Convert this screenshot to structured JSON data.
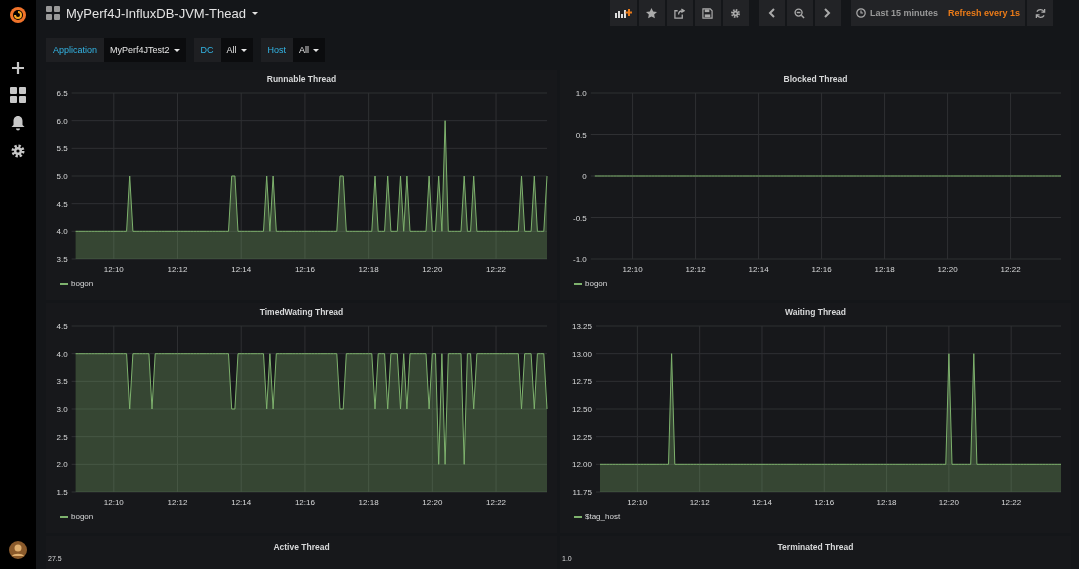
{
  "dashboard": {
    "title": "MyPerf4J-InfluxDB-JVM-Thead"
  },
  "toolbar": {
    "time_range": "Last 15 minutes",
    "refresh": "Refresh every 1s"
  },
  "variables": [
    {
      "label": "Application",
      "value": "MyPerf4JTest2"
    },
    {
      "label": "DC",
      "value": "All"
    },
    {
      "label": "Host",
      "value": "All"
    }
  ],
  "panels": [
    {
      "title": "Runnable Thread",
      "chart_data": {
        "type": "area",
        "grid": true,
        "ylim": [
          3.5,
          6.5
        ],
        "yticks": [
          {
            "value": 3.5,
            "label": "3.5"
          },
          {
            "value": 4,
            "label": "4.0"
          },
          {
            "value": 4.5,
            "label": "4.5"
          },
          {
            "value": 5,
            "label": "5.0"
          },
          {
            "value": 5.5,
            "label": "5.5"
          },
          {
            "value": 6,
            "label": "6.0"
          },
          {
            "value": 6.5,
            "label": "6.5"
          }
        ],
        "categories": [
          null,
          null,
          null,
          null,
          null,
          null,
          null,
          null,
          null,
          null,
          null,
          null,
          "12:10",
          null,
          null,
          null,
          null,
          null,
          null,
          null,
          null,
          null,
          null,
          null,
          null,
          null,
          null,
          null,
          null,
          null,
          null,
          null,
          "12:12",
          null,
          null,
          null,
          null,
          null,
          null,
          null,
          null,
          null,
          null,
          null,
          null,
          null,
          null,
          null,
          null,
          null,
          null,
          null,
          "12:14",
          null,
          null,
          null,
          null,
          null,
          null,
          null,
          null,
          null,
          null,
          null,
          null,
          null,
          null,
          null,
          null,
          null,
          null,
          null,
          "12:16",
          null,
          null,
          null,
          null,
          null,
          null,
          null,
          null,
          null,
          null,
          null,
          null,
          null,
          null,
          null,
          null,
          null,
          null,
          null,
          "12:18",
          null,
          null,
          null,
          null,
          null,
          null,
          null,
          null,
          null,
          null,
          null,
          null,
          null,
          null,
          null,
          null,
          null,
          null,
          null,
          "12:20",
          null,
          null,
          null,
          null,
          null,
          null,
          null,
          null,
          null,
          null,
          null,
          null,
          null,
          null,
          null,
          null,
          null,
          null,
          null,
          "12:22",
          null,
          null,
          null,
          null,
          null,
          null,
          null,
          null,
          null,
          null,
          null,
          null,
          null,
          null,
          null,
          null
        ],
        "series": [
          {
            "name": "bogon",
            "color": "#7eb26d",
            "values": [
              4,
              4,
              4,
              4,
              4,
              4,
              4,
              4,
              4,
              4,
              4,
              4,
              4,
              4,
              4,
              4,
              4,
              5,
              4,
              4,
              4,
              4,
              4,
              4,
              4,
              4,
              4,
              4,
              4,
              4,
              4,
              4,
              4,
              4,
              4,
              4,
              4,
              4,
              4,
              4,
              4,
              4,
              4,
              4,
              4,
              4,
              4,
              4,
              4,
              5,
              5,
              4,
              4,
              4,
              4,
              4,
              4,
              4,
              4,
              4,
              5,
              4,
              5,
              4,
              4,
              4,
              4,
              4,
              4,
              4,
              4,
              4,
              4,
              4,
              4,
              4,
              4,
              4,
              4,
              4,
              4,
              4,
              4,
              5,
              5,
              4,
              4,
              4,
              4,
              4,
              4,
              4,
              4,
              4,
              5,
              4,
              4,
              4,
              5,
              4,
              4,
              4,
              5,
              4,
              5,
              4,
              4,
              4,
              4,
              4,
              4,
              5,
              4,
              4,
              5,
              4,
              6,
              4,
              4,
              4,
              4,
              4,
              5,
              4,
              4,
              5,
              4,
              4,
              4,
              4,
              4,
              4,
              4,
              4,
              4,
              4,
              4,
              4,
              4,
              4,
              5,
              4,
              4,
              4,
              5,
              4,
              4,
              4,
              5
            ]
          }
        ]
      }
    },
    {
      "title": "Blocked Thread",
      "chart_data": {
        "type": "line",
        "grid": true,
        "ylim": [
          -1,
          1
        ],
        "yticks": [
          {
            "value": -1,
            "label": "-1.0"
          },
          {
            "value": -0.5,
            "label": "-0.5"
          },
          {
            "value": 0,
            "label": "0"
          },
          {
            "value": 0.5,
            "label": "0.5"
          },
          {
            "value": 1,
            "label": "1.0"
          }
        ],
        "categories": [
          null,
          null,
          null,
          null,
          null,
          null,
          null,
          null,
          null,
          null,
          null,
          null,
          "12:10",
          null,
          null,
          null,
          null,
          null,
          null,
          null,
          null,
          null,
          null,
          null,
          null,
          null,
          null,
          null,
          null,
          null,
          null,
          null,
          "12:12",
          null,
          null,
          null,
          null,
          null,
          null,
          null,
          null,
          null,
          null,
          null,
          null,
          null,
          null,
          null,
          null,
          null,
          null,
          null,
          "12:14",
          null,
          null,
          null,
          null,
          null,
          null,
          null,
          null,
          null,
          null,
          null,
          null,
          null,
          null,
          null,
          null,
          null,
          null,
          null,
          "12:16",
          null,
          null,
          null,
          null,
          null,
          null,
          null,
          null,
          null,
          null,
          null,
          null,
          null,
          null,
          null,
          null,
          null,
          null,
          null,
          "12:18",
          null,
          null,
          null,
          null,
          null,
          null,
          null,
          null,
          null,
          null,
          null,
          null,
          null,
          null,
          null,
          null,
          null,
          null,
          null,
          "12:20",
          null,
          null,
          null,
          null,
          null,
          null,
          null,
          null,
          null,
          null,
          null,
          null,
          null,
          null,
          null,
          null,
          null,
          null,
          null,
          "12:22",
          null,
          null,
          null,
          null,
          null,
          null,
          null,
          null,
          null,
          null,
          null,
          null,
          null,
          null,
          null,
          null
        ],
        "series": [
          {
            "name": "bogon",
            "color": "#7eb26d",
            "values": [
              0,
              0,
              0,
              0,
              0,
              0,
              0,
              0,
              0,
              0,
              0,
              0,
              0,
              0,
              0,
              0,
              0,
              0,
              0,
              0,
              0,
              0,
              0,
              0,
              0,
              0,
              0,
              0,
              0,
              0,
              0,
              0,
              0,
              0,
              0,
              0,
              0,
              0,
              0,
              0,
              0,
              0,
              0,
              0,
              0,
              0,
              0,
              0,
              0,
              0,
              0,
              0,
              0,
              0,
              0,
              0,
              0,
              0,
              0,
              0,
              0,
              0,
              0,
              0,
              0,
              0,
              0,
              0,
              0,
              0,
              0,
              0,
              0,
              0,
              0,
              0,
              0,
              0,
              0,
              0,
              0,
              0,
              0,
              0,
              0,
              0,
              0,
              0,
              0,
              0,
              0,
              0,
              0,
              0,
              0,
              0,
              0,
              0,
              0,
              0,
              0,
              0,
              0,
              0,
              0,
              0,
              0,
              0,
              0,
              0,
              0,
              0,
              0,
              0,
              0,
              0,
              0,
              0,
              0,
              0,
              0,
              0,
              0,
              0,
              0,
              0,
              0,
              0,
              0,
              0,
              0,
              0,
              0,
              0,
              0,
              0,
              0,
              0,
              0,
              0,
              0,
              0,
              0,
              0,
              0,
              0,
              0,
              0,
              0
            ]
          }
        ]
      }
    },
    {
      "title": "TimedWating Thread",
      "chart_data": {
        "type": "area",
        "grid": true,
        "ylim": [
          1.5,
          4.5
        ],
        "yticks": [
          {
            "value": 1.5,
            "label": "1.5"
          },
          {
            "value": 2,
            "label": "2.0"
          },
          {
            "value": 2.5,
            "label": "2.5"
          },
          {
            "value": 3,
            "label": "3.0"
          },
          {
            "value": 3.5,
            "label": "3.5"
          },
          {
            "value": 4,
            "label": "4.0"
          },
          {
            "value": 4.5,
            "label": "4.5"
          }
        ],
        "categories": [
          null,
          null,
          null,
          null,
          null,
          null,
          null,
          null,
          null,
          null,
          null,
          null,
          "12:10",
          null,
          null,
          null,
          null,
          null,
          null,
          null,
          null,
          null,
          null,
          null,
          null,
          null,
          null,
          null,
          null,
          null,
          null,
          null,
          "12:12",
          null,
          null,
          null,
          null,
          null,
          null,
          null,
          null,
          null,
          null,
          null,
          null,
          null,
          null,
          null,
          null,
          null,
          null,
          null,
          "12:14",
          null,
          null,
          null,
          null,
          null,
          null,
          null,
          null,
          null,
          null,
          null,
          null,
          null,
          null,
          null,
          null,
          null,
          null,
          null,
          "12:16",
          null,
          null,
          null,
          null,
          null,
          null,
          null,
          null,
          null,
          null,
          null,
          null,
          null,
          null,
          null,
          null,
          null,
          null,
          null,
          "12:18",
          null,
          null,
          null,
          null,
          null,
          null,
          null,
          null,
          null,
          null,
          null,
          null,
          null,
          null,
          null,
          null,
          null,
          null,
          null,
          "12:20",
          null,
          null,
          null,
          null,
          null,
          null,
          null,
          null,
          null,
          null,
          null,
          null,
          null,
          null,
          null,
          null,
          null,
          null,
          null,
          "12:22",
          null,
          null,
          null,
          null,
          null,
          null,
          null,
          null,
          null,
          null,
          null,
          null,
          null,
          null,
          null,
          null
        ],
        "series": [
          {
            "name": "bogon",
            "color": "#7eb26d",
            "values": [
              4,
              4,
              4,
              4,
              4,
              4,
              4,
              4,
              4,
              4,
              4,
              4,
              4,
              4,
              4,
              4,
              4,
              3,
              4,
              4,
              4,
              4,
              4,
              4,
              3,
              4,
              4,
              4,
              4,
              4,
              4,
              4,
              4,
              4,
              4,
              4,
              4,
              4,
              4,
              4,
              4,
              4,
              4,
              4,
              4,
              4,
              4,
              4,
              4,
              3,
              3,
              4,
              4,
              4,
              4,
              4,
              4,
              4,
              4,
              4,
              3,
              4,
              3,
              4,
              4,
              4,
              4,
              4,
              4,
              4,
              4,
              4,
              4,
              4,
              4,
              4,
              4,
              4,
              4,
              4,
              4,
              4,
              4,
              3,
              3,
              4,
              4,
              4,
              4,
              4,
              4,
              4,
              4,
              4,
              3,
              4,
              4,
              4,
              3,
              4,
              4,
              4,
              3,
              4,
              3,
              4,
              4,
              4,
              4,
              4,
              4,
              3,
              4,
              4,
              2,
              4,
              2,
              4,
              4,
              4,
              4,
              4,
              2,
              4,
              4,
              3,
              4,
              4,
              4,
              4,
              4,
              4,
              4,
              4,
              4,
              4,
              4,
              4,
              4,
              4,
              3,
              4,
              4,
              4,
              3,
              4,
              4,
              4,
              3
            ]
          }
        ]
      }
    },
    {
      "title": "Waiting Thread",
      "chart_data": {
        "type": "area",
        "grid": true,
        "ylim": [
          11.75,
          13.25
        ],
        "yticks": [
          {
            "value": 11.75,
            "label": "11.75"
          },
          {
            "value": 12,
            "label": "12.00"
          },
          {
            "value": 12.25,
            "label": "12.25"
          },
          {
            "value": 12.5,
            "label": "12.50"
          },
          {
            "value": 12.75,
            "label": "12.75"
          },
          {
            "value": 13,
            "label": "13.00"
          },
          {
            "value": 13.25,
            "label": "13.25"
          }
        ],
        "categories": [
          null,
          null,
          null,
          null,
          null,
          null,
          null,
          null,
          null,
          null,
          null,
          null,
          "12:10",
          null,
          null,
          null,
          null,
          null,
          null,
          null,
          null,
          null,
          null,
          null,
          null,
          null,
          null,
          null,
          null,
          null,
          null,
          null,
          "12:12",
          null,
          null,
          null,
          null,
          null,
          null,
          null,
          null,
          null,
          null,
          null,
          null,
          null,
          null,
          null,
          null,
          null,
          null,
          null,
          "12:14",
          null,
          null,
          null,
          null,
          null,
          null,
          null,
          null,
          null,
          null,
          null,
          null,
          null,
          null,
          null,
          null,
          null,
          null,
          null,
          "12:16",
          null,
          null,
          null,
          null,
          null,
          null,
          null,
          null,
          null,
          null,
          null,
          null,
          null,
          null,
          null,
          null,
          null,
          null,
          null,
          "12:18",
          null,
          null,
          null,
          null,
          null,
          null,
          null,
          null,
          null,
          null,
          null,
          null,
          null,
          null,
          null,
          null,
          null,
          null,
          null,
          "12:20",
          null,
          null,
          null,
          null,
          null,
          null,
          null,
          null,
          null,
          null,
          null,
          null,
          null,
          null,
          null,
          null,
          null,
          null,
          null,
          "12:22",
          null,
          null,
          null,
          null,
          null,
          null,
          null,
          null,
          null,
          null,
          null,
          null,
          null,
          null,
          null,
          null
        ],
        "series": [
          {
            "name": "$tag_host",
            "color": "#7eb26d",
            "values": [
              12,
              12,
              12,
              12,
              12,
              12,
              12,
              12,
              12,
              12,
              12,
              12,
              12,
              12,
              12,
              12,
              12,
              12,
              12,
              12,
              12,
              12,
              12,
              13,
              12,
              12,
              12,
              12,
              12,
              12,
              12,
              12,
              12,
              12,
              12,
              12,
              12,
              12,
              12,
              12,
              12,
              12,
              12,
              12,
              12,
              12,
              12,
              12,
              12,
              12,
              12,
              12,
              12,
              12,
              12,
              12,
              12,
              12,
              12,
              12,
              12,
              12,
              12,
              12,
              12,
              12,
              12,
              12,
              12,
              12,
              12,
              12,
              12,
              12,
              12,
              12,
              12,
              12,
              12,
              12,
              12,
              12,
              12,
              12,
              12,
              12,
              12,
              12,
              12,
              12,
              12,
              12,
              12,
              12,
              12,
              12,
              12,
              12,
              12,
              12,
              12,
              12,
              12,
              12,
              12,
              12,
              12,
              12,
              12,
              12,
              12,
              12,
              13,
              12,
              12,
              12,
              12,
              12,
              12,
              12,
              13,
              12,
              12,
              12,
              12,
              12,
              12,
              12,
              12,
              12,
              12,
              12,
              12,
              12,
              12,
              12,
              12,
              12,
              12,
              12,
              12,
              12,
              12,
              12,
              12,
              12,
              12,
              12,
              12
            ]
          }
        ]
      }
    }
  ],
  "partial_panels": [
    {
      "title": "Active Thread",
      "first_tick": "27.5"
    },
    {
      "title": "Terminated Thread",
      "first_tick": "1.0"
    }
  ]
}
